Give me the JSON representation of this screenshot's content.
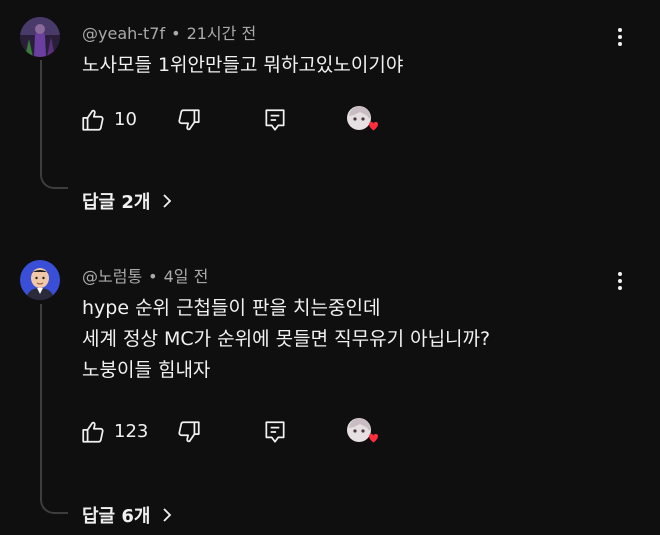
{
  "comments": [
    {
      "author": "@yeah-t7f",
      "separator": "•",
      "time": "21시간 전",
      "lines": [
        "노사모들 1위안만들고 뭐하고있노이기야"
      ],
      "likes": "10",
      "replies_label": "답글 2개"
    },
    {
      "author": "@노럼통",
      "separator": "•",
      "time": "4일 전",
      "lines": [
        "hype 순위 근첩들이 판을 치는중인데",
        "세계 정상 MC가 순위에 못들면 직무유기 아닙니까?",
        "노붕이들 힘내자"
      ],
      "likes": "123",
      "replies_label": "답글 6개"
    }
  ],
  "icons": {
    "like": "thumb-up-icon",
    "dislike": "thumb-down-icon",
    "reply": "reply-comment-icon",
    "more": "more-vertical-icon",
    "creator_heart": "creator-heart-icon",
    "expand": "chevron-right-icon"
  },
  "colors": {
    "background": "#0f0f0f",
    "text": "#f1f1f1",
    "meta": "#aaaaaa",
    "heart": "#ff2d3d"
  }
}
